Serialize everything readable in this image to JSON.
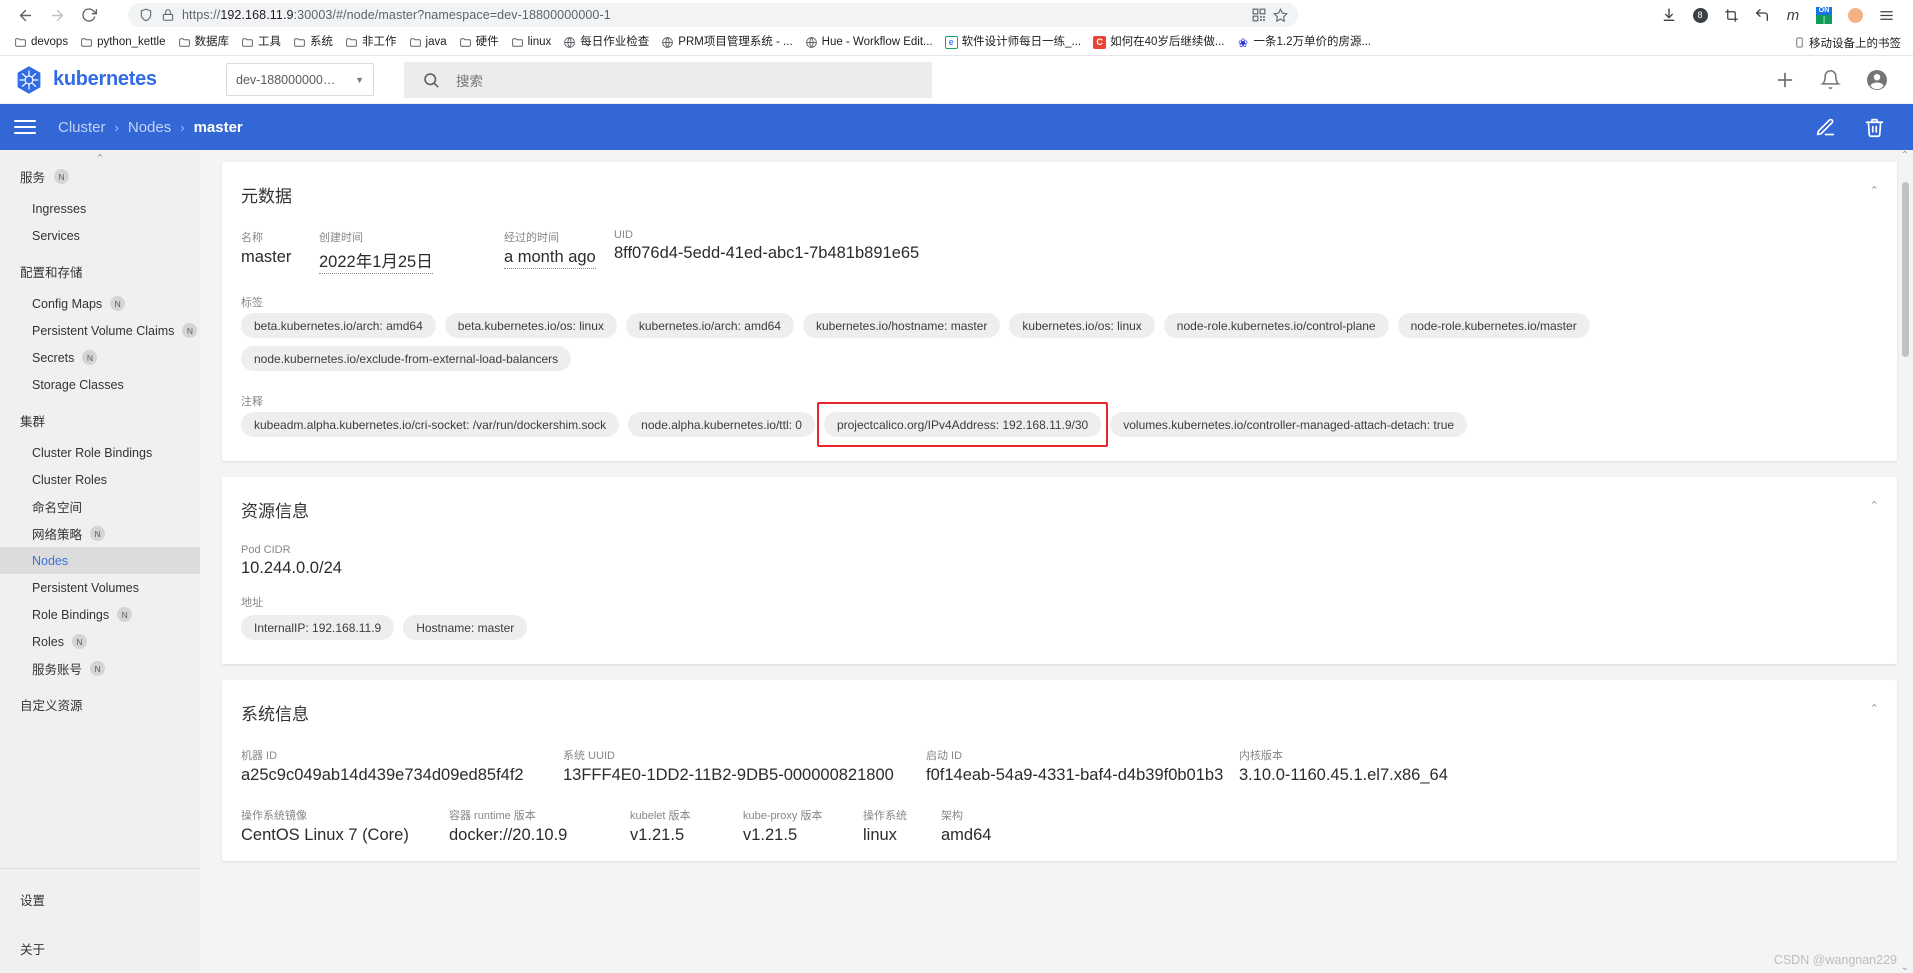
{
  "browser": {
    "nav": {
      "back_icon": "arrow-left-icon",
      "forward_icon": "arrow-right-icon",
      "reload_icon": "reload-icon"
    },
    "url": {
      "shield_icon": "shield-icon",
      "lock_warning_icon": "lock-warning-icon",
      "protocol": "https://",
      "host": "192.168.11.9",
      "port": ":30003",
      "path": "/#/node/master?namespace=dev-18800000000-1",
      "full": "https://192.168.11.9:30003/#/node/master?namespace=dev-18800000000-1",
      "qr_icon": "qr-code-icon",
      "bookmark_star_icon": "star-icon"
    },
    "actions": [
      {
        "name": "downloads-icon",
        "glyph": "⤓"
      },
      {
        "name": "extension-badge-icon",
        "glyph": "8"
      },
      {
        "name": "screenshot-crop-icon",
        "glyph": "⛶"
      },
      {
        "name": "undo-arrow-icon",
        "glyph": "↰"
      },
      {
        "name": "metamask-icon",
        "glyph": "m"
      },
      {
        "name": "on-toggle-icon",
        "glyph": "ON"
      },
      {
        "name": "profile-avatar-icon",
        "glyph": "☻"
      },
      {
        "name": "browser-menu-icon",
        "glyph": "≡"
      }
    ],
    "bookmarks": [
      {
        "label": "devops",
        "icon": "folder-icon",
        "kind": "folder"
      },
      {
        "label": "python_kettle",
        "icon": "folder-icon",
        "kind": "folder"
      },
      {
        "label": "数据库",
        "icon": "folder-icon",
        "kind": "folder"
      },
      {
        "label": "工具",
        "icon": "folder-icon",
        "kind": "folder"
      },
      {
        "label": "系统",
        "icon": "folder-icon",
        "kind": "folder"
      },
      {
        "label": "非工作",
        "icon": "folder-icon",
        "kind": "folder"
      },
      {
        "label": "java",
        "icon": "folder-icon",
        "kind": "folder"
      },
      {
        "label": "硬件",
        "icon": "folder-icon",
        "kind": "folder"
      },
      {
        "label": "linux",
        "icon": "folder-icon",
        "kind": "folder"
      },
      {
        "label": "每日作业检查",
        "icon": "globe-icon",
        "kind": "globe"
      },
      {
        "label": "PRM项目管理系统 - ...",
        "icon": "globe-icon",
        "kind": "globe"
      },
      {
        "label": "Hue - Workflow Edit...",
        "icon": "globe-icon",
        "kind": "globe"
      },
      {
        "label": "软件设计师每日一练_...",
        "icon": "edge-e-icon",
        "kind": "green"
      },
      {
        "label": "如何在40岁后继续做...",
        "icon": "csdn-c-icon",
        "kind": "red"
      },
      {
        "label": "一条1.2万单价的房源...",
        "icon": "baidu-icon",
        "kind": "blue"
      }
    ],
    "bookmarks_right": {
      "label": "移动设备上的书签",
      "icon": "mobile-device-icon"
    }
  },
  "app": {
    "brand": "kubernetes",
    "logo_icon": "kubernetes-helm-icon",
    "namespace_selector": {
      "value": "dev-188000000…",
      "chevron_icon": "chevron-down-icon"
    },
    "search": {
      "placeholder": "搜索",
      "icon": "search-icon"
    },
    "header_actions": [
      {
        "name": "create-resource-icon",
        "glyph": "+"
      },
      {
        "name": "notifications-bell-icon",
        "glyph": "bell"
      },
      {
        "name": "account-circle-icon",
        "glyph": "account"
      }
    ]
  },
  "breadcrumb": {
    "menu_icon": "hamburger-menu-icon",
    "items": [
      {
        "label": "Cluster",
        "current": false
      },
      {
        "label": "Nodes",
        "current": false
      },
      {
        "label": "master",
        "current": true
      }
    ],
    "separator": "›",
    "actions": [
      {
        "name": "edit-pencil-icon",
        "glyph": "pencil"
      },
      {
        "name": "delete-trash-icon",
        "glyph": "trash"
      }
    ]
  },
  "sidebar": {
    "scroll_up_icon": "chevron-up-icon",
    "groups": [
      {
        "title": "服务",
        "badge": "N",
        "items": [
          {
            "label": "Ingresses",
            "badge": "",
            "active": false
          },
          {
            "label": "Services",
            "badge": "",
            "active": false
          }
        ]
      },
      {
        "title": "配置和存储",
        "badge": "",
        "items": [
          {
            "label": "Config Maps",
            "badge": "N",
            "active": false
          },
          {
            "label": "Persistent Volume Claims",
            "badge": "N",
            "active": false
          },
          {
            "label": "Secrets",
            "badge": "N",
            "active": false
          },
          {
            "label": "Storage Classes",
            "badge": "",
            "active": false
          }
        ]
      },
      {
        "title": "集群",
        "badge": "",
        "items": [
          {
            "label": "Cluster Role Bindings",
            "badge": "",
            "active": false
          },
          {
            "label": "Cluster Roles",
            "badge": "",
            "active": false
          },
          {
            "label": "命名空间",
            "badge": "",
            "active": false
          },
          {
            "label": "网络策略",
            "badge": "N",
            "active": false
          },
          {
            "label": "Nodes",
            "badge": "",
            "active": true
          },
          {
            "label": "Persistent Volumes",
            "badge": "",
            "active": false
          },
          {
            "label": "Role Bindings",
            "badge": "N",
            "active": false
          },
          {
            "label": "Roles",
            "badge": "N",
            "active": false
          },
          {
            "label": "服务账号",
            "badge": "N",
            "active": false
          }
        ]
      },
      {
        "title": "自定义资源",
        "badge": "",
        "items": []
      }
    ],
    "footer_items": [
      {
        "label": "设置"
      },
      {
        "label": "关于"
      }
    ]
  },
  "metadata_card": {
    "title": "元数据",
    "collapse_icon": "chevron-up-icon",
    "fields": [
      {
        "label": "名称",
        "value": "master",
        "underline": false
      },
      {
        "label": "创建时间",
        "value": "2022年1月25日",
        "underline": true
      },
      {
        "label": "经过的时间",
        "value": "a month ago",
        "underline": true
      },
      {
        "label": "UID",
        "value": "8ff076d4-5edd-41ed-abc1-7b481b891e65",
        "underline": false
      }
    ],
    "labels_title": "标签",
    "labels": [
      "beta.kubernetes.io/arch: amd64",
      "beta.kubernetes.io/os: linux",
      "kubernetes.io/arch: amd64",
      "kubernetes.io/hostname: master",
      "kubernetes.io/os: linux",
      "node-role.kubernetes.io/control-plane",
      "node-role.kubernetes.io/master",
      "node.kubernetes.io/exclude-from-external-load-balancers"
    ],
    "annotations_title": "注释",
    "annotations": [
      "kubeadm.alpha.kubernetes.io/cri-socket: /var/run/dockershim.sock",
      "node.alpha.kubernetes.io/ttl: 0",
      "projectcalico.org/IPv4Address: 192.168.11.9/30",
      "volumes.kubernetes.io/controller-managed-attach-detach: true"
    ],
    "highlight": {
      "target": "projectcalico.org/IPv4Address: 192.168.11.9/30",
      "color": "#e8262a"
    }
  },
  "resource_card": {
    "title": "资源信息",
    "collapse_icon": "chevron-up-icon",
    "pod_cidr_label": "Pod CIDR",
    "pod_cidr_value": "10.244.0.0/24",
    "addresses_label": "地址",
    "addresses": [
      "InternalIP: 192.168.11.9",
      "Hostname: master"
    ]
  },
  "system_card": {
    "title": "系统信息",
    "collapse_icon": "chevron-up-icon",
    "row1": [
      {
        "label": "机器 ID",
        "value": "a25c9c049ab14d439e734d09ed85f4f2"
      },
      {
        "label": "系统 UUID",
        "value": "13FFF4E0-1DD2-11B2-9DB5-000000821800"
      },
      {
        "label": "启动 ID",
        "value": "f0f14eab-54a9-4331-baf4-d4b39f0b01b3"
      },
      {
        "label": "内核版本",
        "value": "3.10.0-1160.45.1.el7.x86_64"
      }
    ],
    "row2": [
      {
        "label": "操作系统镜像",
        "value": "CentOS Linux 7 (Core)"
      },
      {
        "label": "容器 runtime 版本",
        "value": "docker://20.10.9"
      },
      {
        "label": "kubelet 版本",
        "value": "v1.21.5"
      },
      {
        "label": "kube-proxy 版本",
        "value": "v1.21.5"
      },
      {
        "label": "操作系统",
        "value": "linux"
      },
      {
        "label": "架构",
        "value": "amd64"
      }
    ]
  },
  "watermark": "CSDN @wangnan229",
  "colors": {
    "k8s_blue": "#326ce5",
    "breadcrumb_blue": "#3367d6",
    "active_nav_text": "#3f6fd8",
    "highlight_red": "#e8262a",
    "sidebar_bg": "#f0f0f0",
    "page_bg": "#f4f4f4"
  }
}
